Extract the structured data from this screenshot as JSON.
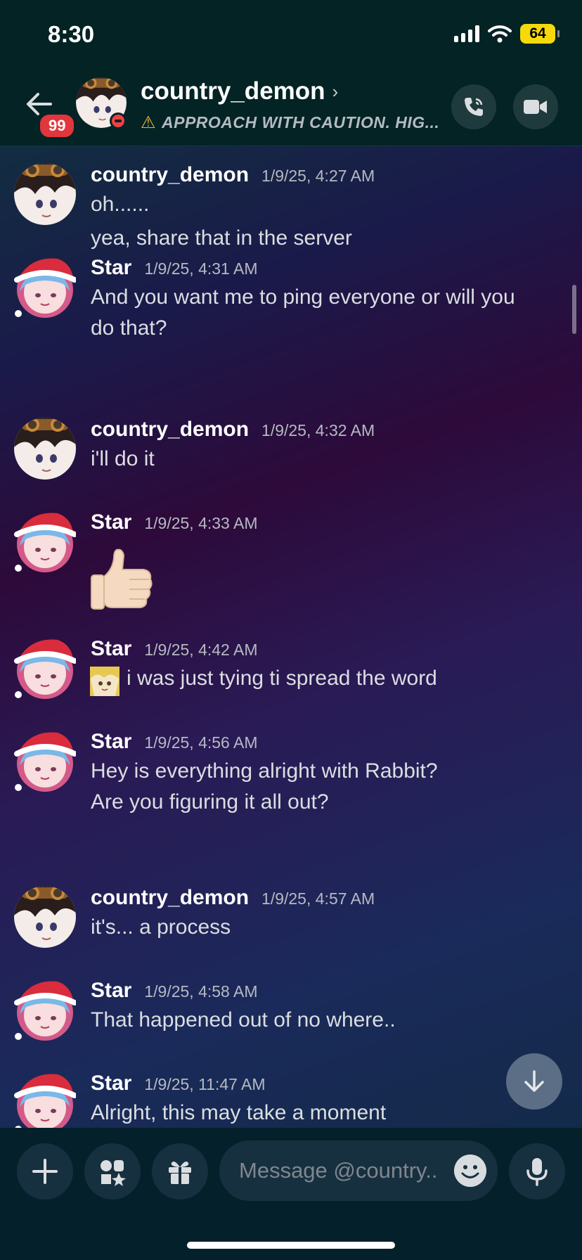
{
  "status_bar": {
    "time": "8:30",
    "battery": "64"
  },
  "header": {
    "unread_badge": "99",
    "name": "country_demon",
    "chevron": "›",
    "subtitle": "APPROACH WITH CAUTION. HIG..."
  },
  "messages": [
    {
      "author": "country_demon",
      "timestamp": "1/9/25, 4:27 AM",
      "lines": [
        "oh......",
        "yea, share that in the server"
      ]
    },
    {
      "author": "Star",
      "timestamp": "1/9/25, 4:31 AM",
      "lines": [
        "And you want me to ping everyone or will you",
        "do that?"
      ]
    },
    {
      "author": "country_demon",
      "timestamp": "1/9/25, 4:32 AM",
      "lines": [
        "i'll do it"
      ]
    },
    {
      "author": "Star",
      "timestamp": "1/9/25, 4:33 AM",
      "lines": [],
      "emoji": "thumbs-up"
    },
    {
      "author": "Star",
      "timestamp": "1/9/25, 4:42 AM",
      "lines": [
        "i was just tying ti spread the word"
      ],
      "inline_sticker": "anime-girl-emoji"
    },
    {
      "author": "Star",
      "timestamp": "1/9/25, 4:56 AM",
      "lines": [
        "Hey is everything alright with Rabbit?",
        "Are you figuring it all out?"
      ]
    },
    {
      "author": "country_demon",
      "timestamp": "1/9/25, 4:57 AM",
      "lines": [
        "it's... a process"
      ]
    },
    {
      "author": "Star",
      "timestamp": "1/9/25, 4:58 AM",
      "lines": [
        "That happened out of no where.."
      ]
    },
    {
      "author": "Star",
      "timestamp": "1/9/25, 11:47 AM",
      "lines": [
        "Alright, this may take a moment"
      ]
    }
  ],
  "composer": {
    "placeholder": "Message @country..",
    "buttons": [
      "plus-icon",
      "apps-icon",
      "gift-icon",
      "emoji-icon",
      "microphone-icon"
    ]
  },
  "colors": {
    "header_bg": "#032324",
    "badge_red": "#e2363d",
    "warning_yellow": "#f0b232",
    "battery_yellow": "#f5d90a"
  }
}
